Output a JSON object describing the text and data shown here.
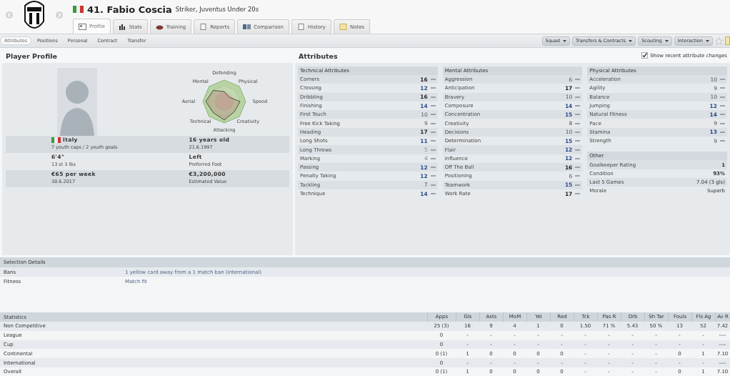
{
  "header": {
    "number_name": "41. Fabio Coscia",
    "subtitle": "Striker, Juventus Under 20s"
  },
  "tabs": [
    {
      "label": "Profile",
      "kind": "card",
      "selected": true
    },
    {
      "label": "Stats",
      "kind": "bars",
      "selected": false
    },
    {
      "label": "Training",
      "kind": "ball",
      "selected": false
    },
    {
      "label": "Reports",
      "kind": "doc",
      "selected": false
    },
    {
      "label": "Comparison",
      "kind": "compare",
      "selected": false
    },
    {
      "label": "History",
      "kind": "doc",
      "selected": false
    },
    {
      "label": "Notes",
      "kind": "note",
      "selected": false
    }
  ],
  "subtabs": [
    {
      "label": "Attributes",
      "selected": true
    },
    {
      "label": "Positions",
      "selected": false
    },
    {
      "label": "Personal",
      "selected": false
    },
    {
      "label": "Contract",
      "selected": false
    },
    {
      "label": "Transfer",
      "selected": false
    }
  ],
  "menus": [
    "Squad",
    "Transfers & Contracts",
    "Scouting",
    "Interaction"
  ],
  "profile": {
    "title": "Player Profile",
    "radar_labels": [
      "Defending",
      "Physical",
      "Speed",
      "Creativity",
      "Attacking",
      "Technical",
      "Aerial",
      "Mental"
    ],
    "info": [
      {
        "main": "Italy",
        "sub": "7 youth caps / 2 youth goals",
        "kind": "nationality"
      },
      {
        "main": "16 years old",
        "sub": "21.6.1997",
        "kind": "plain"
      },
      {
        "main": "6'4\"",
        "sub": "13 st 3 lbs",
        "kind": "plain"
      },
      {
        "main": "Left",
        "sub": "Preferred Foot",
        "kind": "plain"
      },
      {
        "main": "€65 per week",
        "sub": "30.6.2017",
        "kind": "plain"
      },
      {
        "main": "€3,200,000",
        "sub": "Estimated Value",
        "kind": "plain"
      }
    ]
  },
  "attributes": {
    "title": "Attributes",
    "show_changes": {
      "label": "Show recent attribute changes",
      "checked": true
    },
    "groups": [
      {
        "title": "Technical Attributes",
        "items": [
          {
            "name": "Corners",
            "value": "16"
          },
          {
            "name": "Crossing",
            "value": "12"
          },
          {
            "name": "Dribbling",
            "value": "16"
          },
          {
            "name": "Finishing",
            "value": "14"
          },
          {
            "name": "First Touch",
            "value": "10"
          },
          {
            "name": "Free Kick Taking",
            "value": "9"
          },
          {
            "name": "Heading",
            "value": "17"
          },
          {
            "name": "Long Shots",
            "value": "11"
          },
          {
            "name": "Long Throws",
            "value": "5"
          },
          {
            "name": "Marking",
            "value": "4"
          },
          {
            "name": "Passing",
            "value": "12"
          },
          {
            "name": "Penalty Taking",
            "value": "12"
          },
          {
            "name": "Tackling",
            "value": "7"
          },
          {
            "name": "Technique",
            "value": "14"
          }
        ]
      },
      {
        "title": "Mental Attributes",
        "items": [
          {
            "name": "Aggression",
            "value": "6"
          },
          {
            "name": "Anticipation",
            "value": "17"
          },
          {
            "name": "Bravery",
            "value": "10"
          },
          {
            "name": "Composure",
            "value": "14"
          },
          {
            "name": "Concentration",
            "value": "15"
          },
          {
            "name": "Creativity",
            "value": "8"
          },
          {
            "name": "Decisions",
            "value": "10"
          },
          {
            "name": "Determination",
            "value": "15"
          },
          {
            "name": "Flair",
            "value": "12"
          },
          {
            "name": "Influence",
            "value": "12"
          },
          {
            "name": "Off The Ball",
            "value": "16"
          },
          {
            "name": "Positioning",
            "value": "6"
          },
          {
            "name": "Teamwork",
            "value": "15"
          },
          {
            "name": "Work Rate",
            "value": "17"
          }
        ]
      },
      {
        "title": "Physical Attributes",
        "items": [
          {
            "name": "Acceleration",
            "value": "10"
          },
          {
            "name": "Agility",
            "value": "9"
          },
          {
            "name": "Balance",
            "value": "10"
          },
          {
            "name": "Jumping",
            "value": "12"
          },
          {
            "name": "Natural Fitness",
            "value": "14"
          },
          {
            "name": "Pace",
            "value": "9"
          },
          {
            "name": "Stamina",
            "value": "13"
          },
          {
            "name": "Strength",
            "value": "9"
          }
        ]
      }
    ],
    "other": {
      "title": "Other",
      "items": [
        {
          "name": "Goalkeeper Rating",
          "value": "1",
          "bold": true
        },
        {
          "name": "Condition",
          "value": "93%",
          "bold": true
        },
        {
          "name": "Last 5 Games",
          "value": "7.04 (3 gls)",
          "bold": false
        },
        {
          "name": "Morale",
          "value": "Superb",
          "bold": false
        }
      ]
    }
  },
  "selection_details": {
    "title": "Selection Details",
    "rows": [
      {
        "label": "Bans",
        "value": "1 yellow card away from a 1 match ban (international)"
      },
      {
        "label": "Fitness",
        "value": "Match fit"
      }
    ]
  },
  "statistics": {
    "title": "Statistics",
    "columns": [
      "Apps",
      "Gls",
      "Asts",
      "MoM",
      "Yel",
      "Red",
      "Tck",
      "Pas R",
      "Drb",
      "Sh Tar",
      "Fouls",
      "Fls Ag",
      "Av R"
    ],
    "rows": [
      {
        "label": "Non Competitive",
        "cells": [
          "25 (3)",
          "16",
          "9",
          "4",
          "1",
          "0",
          "1.50",
          "71 %",
          "5.43",
          "50 %",
          "13",
          "52",
          "7.42"
        ]
      },
      {
        "label": "League",
        "cells": [
          "0",
          "-",
          "-",
          "-",
          "-",
          "-",
          "-",
          "-",
          "-",
          "-",
          "-",
          "-",
          "----"
        ]
      },
      {
        "label": "Cup",
        "cells": [
          "0",
          "-",
          "-",
          "-",
          "-",
          "-",
          "-",
          "-",
          "-",
          "-",
          "-",
          "-",
          "----"
        ]
      },
      {
        "label": "Continental",
        "cells": [
          "0 (1)",
          "1",
          "0",
          "0",
          "0",
          "0",
          "-",
          "-",
          "-",
          "-",
          "0",
          "1",
          "7.10"
        ]
      },
      {
        "label": "International",
        "cells": [
          "0",
          "-",
          "-",
          "-",
          "-",
          "-",
          "-",
          "-",
          "-",
          "-",
          "-",
          "-",
          "----"
        ]
      },
      {
        "label": "Overall",
        "cells": [
          "0 (1)",
          "1",
          "0",
          "0",
          "0",
          "0",
          "-",
          "-",
          "-",
          "-",
          "0",
          "1",
          "7.10"
        ]
      }
    ]
  }
}
